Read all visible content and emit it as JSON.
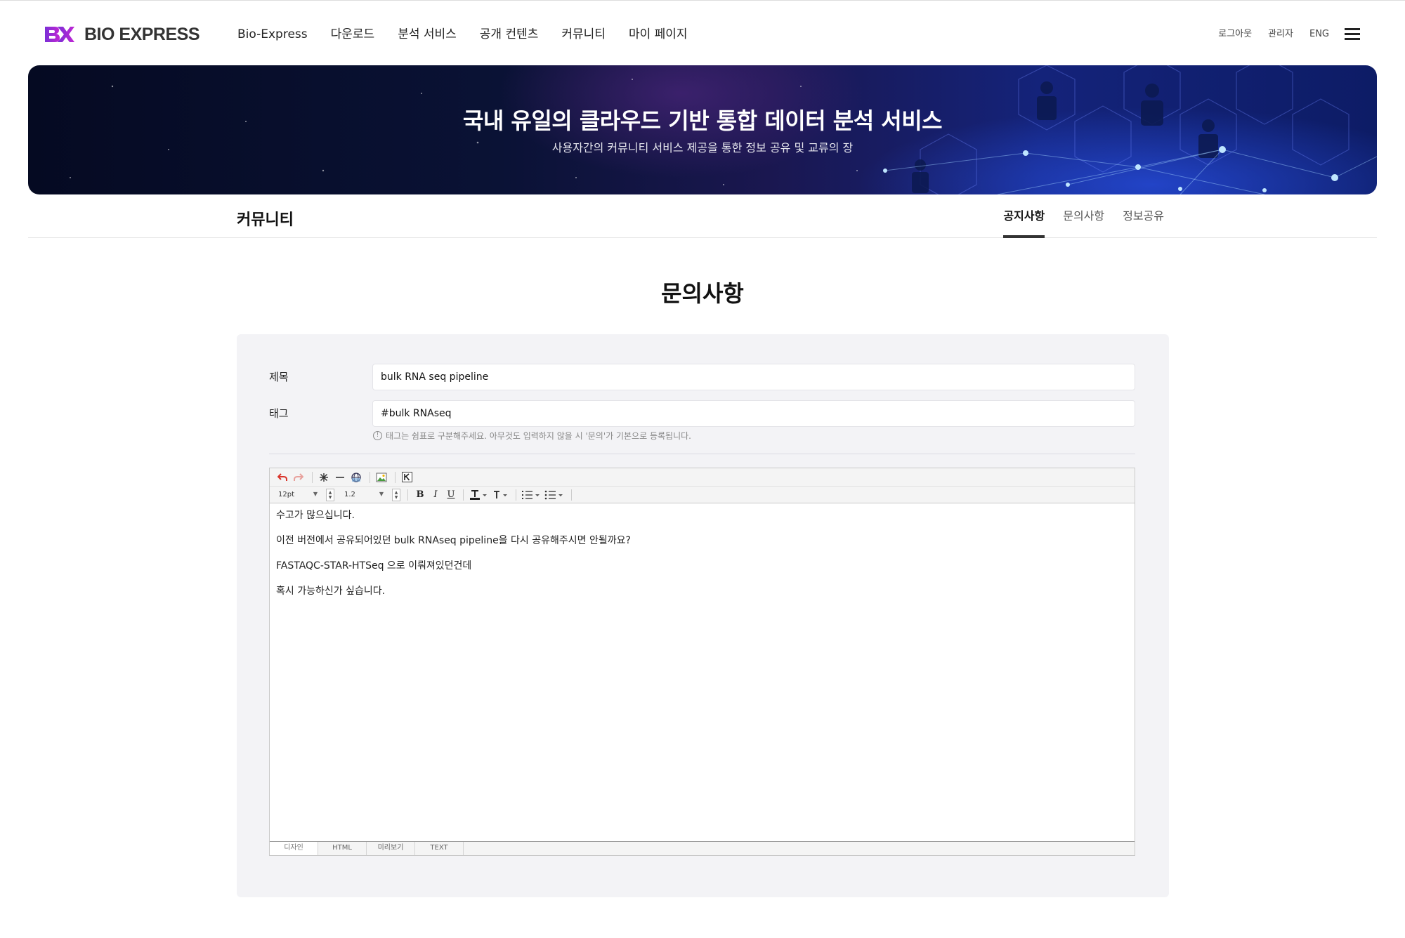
{
  "header": {
    "logo_text": "BIO EXPRESS",
    "nav": [
      "Bio-Express",
      "다운로드",
      "분석 서비스",
      "공개 컨텐츠",
      "커뮤니티",
      "마이 페이지"
    ],
    "util": [
      "로그아웃",
      "관리자",
      "ENG"
    ]
  },
  "banner": {
    "title": "국내 유일의 클라우드 기반 통합 데이터 분석 서비스",
    "subtitle": "사용자간의 커뮤니티 서비스 제공을 통한 정보 공유 및 교류의 장"
  },
  "subnav": {
    "title": "커뮤니티",
    "tabs": [
      "공지사항",
      "문의사항",
      "정보공유"
    ],
    "active_tab": "공지사항"
  },
  "page": {
    "title": "문의사항"
  },
  "form": {
    "subject_label": "제목",
    "subject_value": "bulk RNA seq pipeline",
    "tag_label": "태그",
    "tag_value": "#bulk RNAseq",
    "tag_hint": "태그는 쉼표로 구분해주세요. 아무것도 입력하지 않을 시 '문의'가 기본으로 등록됩니다.",
    "hint_icon": "!"
  },
  "editor": {
    "font_size": "12pt",
    "line_height": "1.2",
    "format_bold": "B",
    "format_italic": "I",
    "format_underline": "U",
    "body": [
      "수고가 많으십니다.",
      "이전 버전에서 공유되어있던 bulk RNAseq pipeline을 다시 공유해주시면 안될까요?",
      "FASTAQC-STAR-HTSeq  으로 이뤄져있던건데",
      "혹시 가능하신가 싶습니다."
    ],
    "modes": [
      "디자인",
      "HTML",
      "미리보기",
      "TEXT"
    ],
    "active_mode": "디자인"
  },
  "colors": {
    "logo_purple": "#7b2fd6",
    "logo_magenta": "#c026d3",
    "undo_red": "#d9352b",
    "active_tab_underline": "#333333",
    "card_bg": "#f3f3f6"
  }
}
